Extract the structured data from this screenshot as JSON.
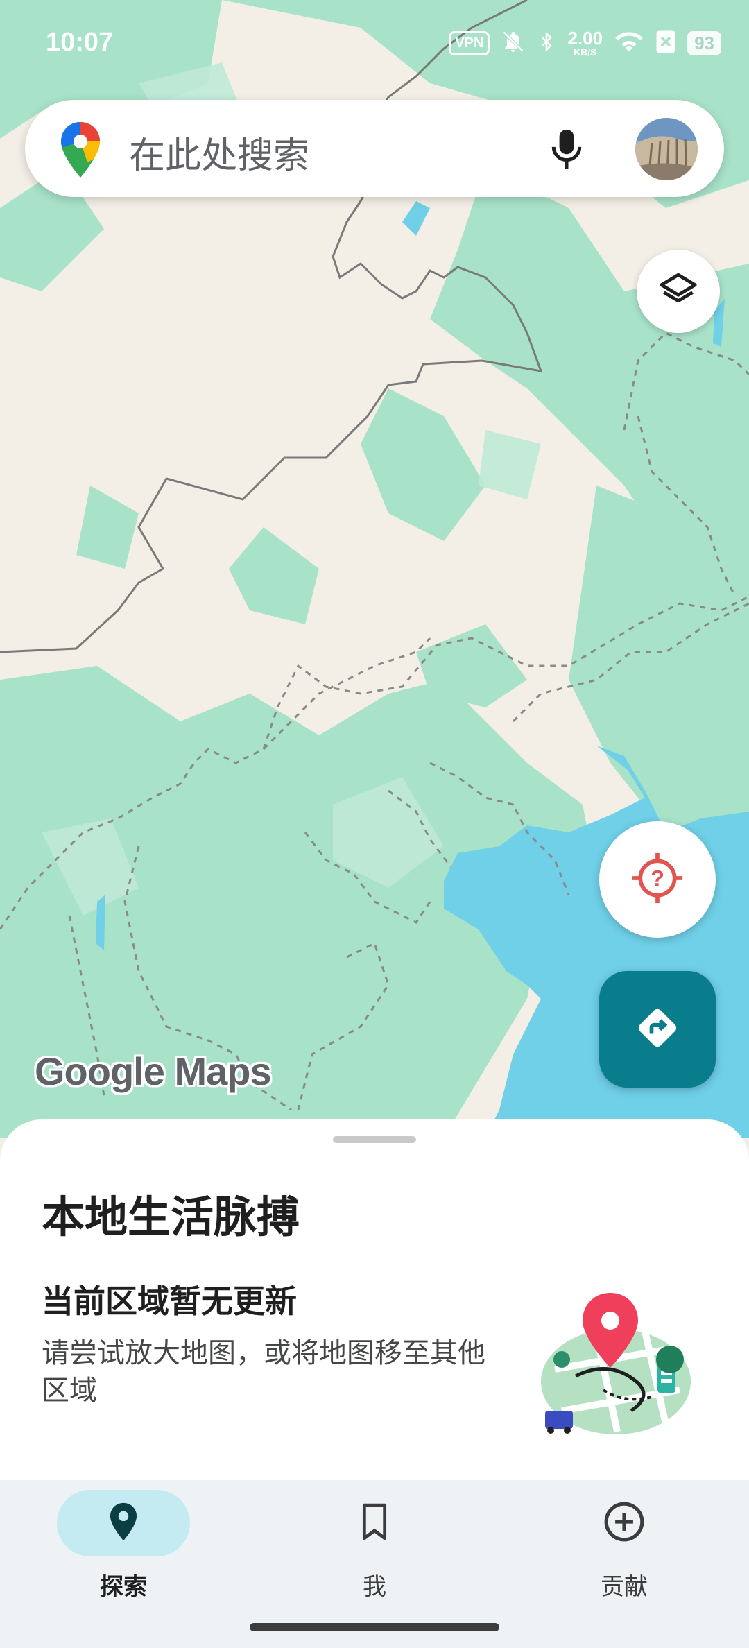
{
  "status_bar": {
    "time": "10:07",
    "vpn_label": "VPN",
    "net_speed": "2.00",
    "net_unit": "KB/S",
    "battery": "93"
  },
  "search": {
    "placeholder": "在此处搜索"
  },
  "map": {
    "brand": "Google Maps",
    "colors": {
      "land": "#f3efe6",
      "vegetation": "#a8e2c9",
      "water": "#6fd0e8",
      "accent": "#0a7d8c",
      "location_icon": "#e0554f"
    }
  },
  "sheet": {
    "title": "本地生活脉搏",
    "subtitle": "当前区域暂无更新",
    "description": "请尝试放大地图，或将地图移至其他区域"
  },
  "nav": {
    "items": [
      {
        "label": "探索",
        "icon": "explore-pin-icon",
        "active": true
      },
      {
        "label": "我",
        "icon": "bookmark-icon",
        "active": false
      },
      {
        "label": "贡献",
        "icon": "add-circle-icon",
        "active": false
      }
    ]
  }
}
